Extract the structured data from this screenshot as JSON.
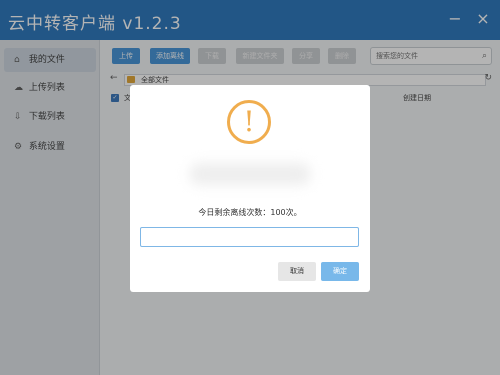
{
  "app": {
    "title": "云中转客户端 v1.2.3"
  },
  "window_controls": {
    "minimize": "−",
    "close": "×"
  },
  "sidebar": {
    "items": [
      {
        "icon": "home-icon",
        "glyph": "⌂",
        "label": "我的文件"
      },
      {
        "icon": "cloud-upload-icon",
        "glyph": "☁",
        "label": "上传列表"
      },
      {
        "icon": "download-icon",
        "glyph": "⇩",
        "label": "下载列表"
      },
      {
        "icon": "gear-icon",
        "glyph": "⚙",
        "label": "系统设置"
      }
    ]
  },
  "toolbar": {
    "upload": "上传",
    "add_offline": "添加离线",
    "download": "下载",
    "new_folder": "新建文件夹",
    "share": "分享",
    "delete": "删除"
  },
  "search": {
    "placeholder": "搜索您的文件",
    "icon_glyph": "⌕"
  },
  "pathbar": {
    "back_glyph": "←",
    "path": "全部文件",
    "refresh_glyph": "↻"
  },
  "table": {
    "check_glyph": "✓",
    "col_name": "文",
    "col_date": "创建日期"
  },
  "dialog": {
    "icon_glyph": "!",
    "message": "今日剩余离线次数：100次。",
    "input_value": "",
    "cancel_label": "取消",
    "ok_label": "确定"
  }
}
